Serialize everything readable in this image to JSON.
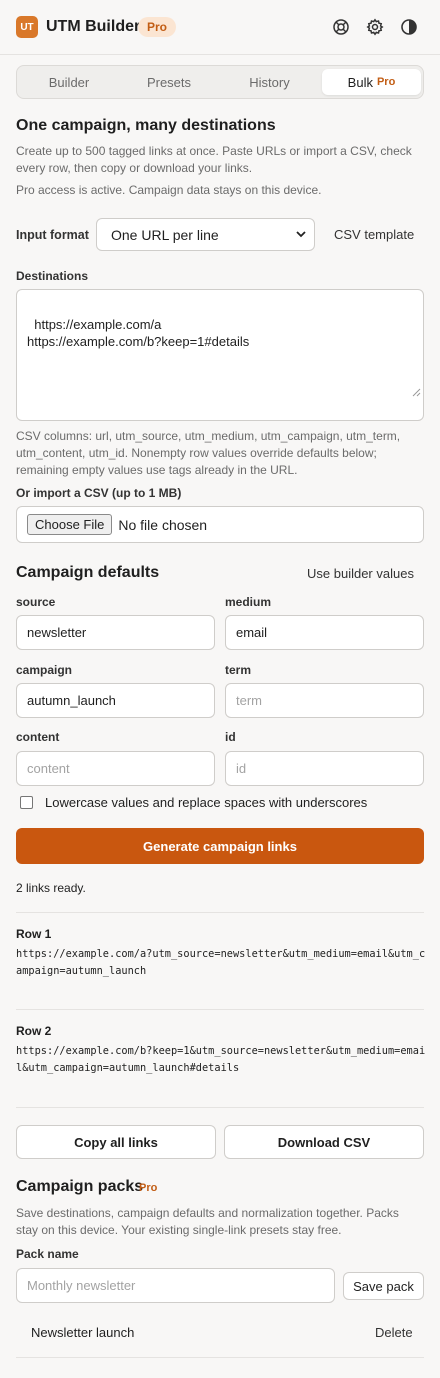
{
  "header": {
    "logo_text": "UT",
    "title": "UTM Builder",
    "badge": "Pro",
    "icons": [
      "help-icon",
      "gear-icon",
      "contrast-icon"
    ]
  },
  "tabs": [
    {
      "label": "Builder",
      "active": false
    },
    {
      "label": "Presets",
      "active": false
    },
    {
      "label": "History",
      "active": false
    },
    {
      "label": "Bulk",
      "badge": "Pro",
      "active": true
    }
  ],
  "bulk": {
    "heading": "One campaign, many destinations",
    "description": "Create up to 500 tagged links at once. Paste URLs or import a CSV, check every row, then copy or download your links.",
    "pro_note": "Pro access is active. Campaign data stays on this device.",
    "input_format_label": "Input format",
    "input_format_value": "One URL per line",
    "csv_template_label": "CSV template",
    "destinations_label": "Destinations",
    "destinations_value": "https://example.com/a\nhttps://example.com/b?keep=1#details",
    "csv_help": "CSV columns: url, utm_source, utm_medium, utm_campaign, utm_term, utm_content, utm_id. Nonempty row values override defaults below; remaining empty values use tags already in the URL.",
    "import_label": "Or import a CSV (up to 1 MB)",
    "file_button": "Choose File",
    "file_status": "No file chosen"
  },
  "defaults": {
    "heading": "Campaign defaults",
    "use_builder_label": "Use builder values",
    "source": {
      "label": "source",
      "value": "newsletter",
      "placeholder": "source"
    },
    "medium": {
      "label": "medium",
      "value": "email",
      "placeholder": "medium"
    },
    "campaign": {
      "label": "campaign",
      "value": "autumn_launch",
      "placeholder": "campaign"
    },
    "term": {
      "label": "term",
      "value": "",
      "placeholder": "term"
    },
    "content": {
      "label": "content",
      "value": "",
      "placeholder": "content"
    },
    "id": {
      "label": "id",
      "value": "",
      "placeholder": "id"
    },
    "normalize_label": "Lowercase values and replace spaces with underscores",
    "normalize_checked": false
  },
  "generate": {
    "button_label": "Generate campaign links",
    "status": "2 links ready."
  },
  "results": [
    {
      "title": "Row 1",
      "url": "https://example.com/a?utm_source=newsletter&utm_medium=email&utm_campaign=autumn_launch"
    },
    {
      "title": "Row 2",
      "url": "https://example.com/b?keep=1&utm_source=newsletter&utm_medium=email&utm_campaign=autumn_launch#details"
    }
  ],
  "actions": {
    "copy_all": "Copy all links",
    "download_csv": "Download CSV"
  },
  "packs": {
    "heading": "Campaign packs",
    "badge": "Pro",
    "description": "Save destinations, campaign defaults and normalization together. Packs stay on this device. Your existing single-link presets stay free.",
    "name_label": "Pack name",
    "name_placeholder": "Monthly newsletter",
    "save_label": "Save pack",
    "items": [
      {
        "name": "Newsletter launch",
        "delete_label": "Delete"
      }
    ]
  },
  "colors": {
    "accent": "#c9570f",
    "logo": "#d9782a",
    "badge_bg": "#fbe5d2",
    "badge_text": "#c25d14",
    "background": "#f8f7f6"
  }
}
